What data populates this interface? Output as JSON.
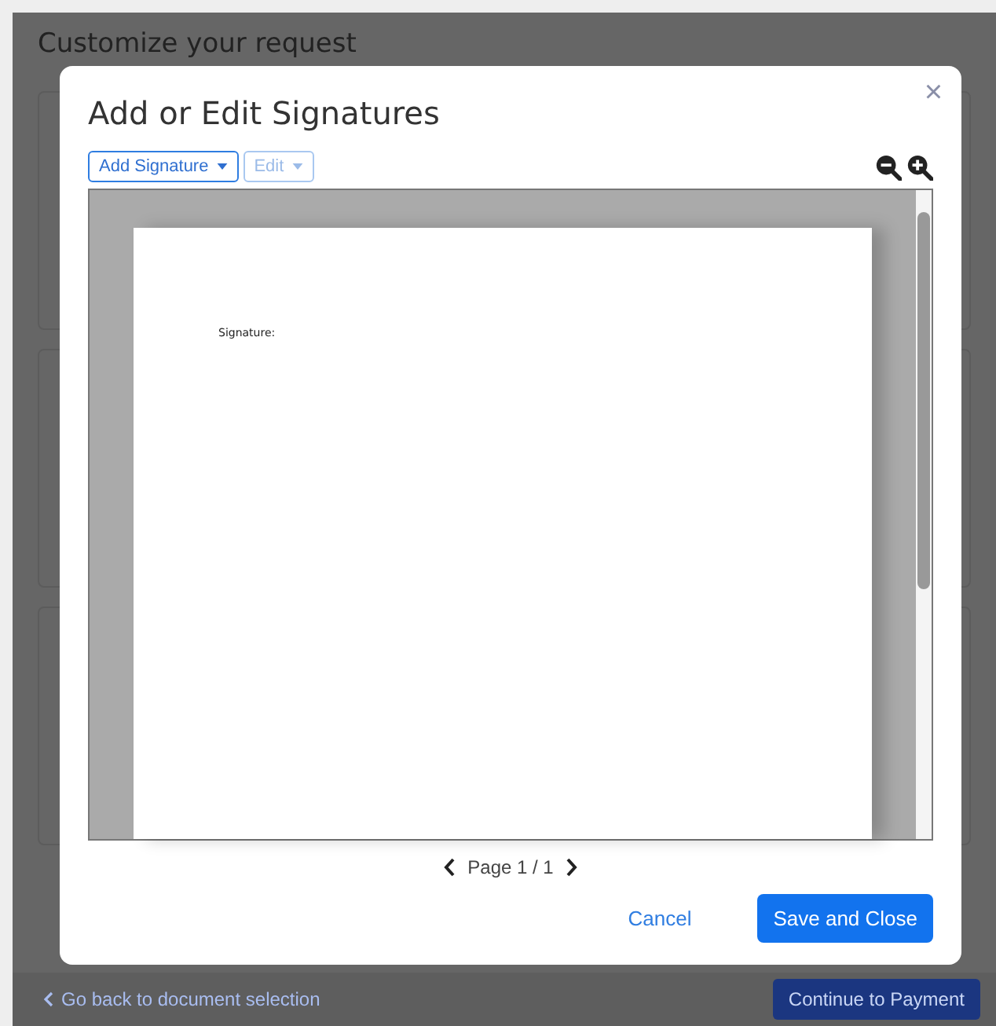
{
  "background": {
    "title": "Customize your request",
    "back_link": "Go back to document selection",
    "continue_button": "Continue to Payment"
  },
  "dialog": {
    "title": "Add or Edit Signatures",
    "close": "×",
    "toolbar": [
      {
        "label": "Add Signature",
        "disabled": false
      },
      {
        "label": "Edit",
        "disabled": true
      }
    ],
    "document": {
      "text": "Signature:"
    },
    "pager": {
      "label": "Page 1 / 1"
    },
    "buttons": [
      {
        "label": "Cancel",
        "kind": "link"
      },
      {
        "label": "Save and Close",
        "kind": "primary"
      }
    ]
  }
}
